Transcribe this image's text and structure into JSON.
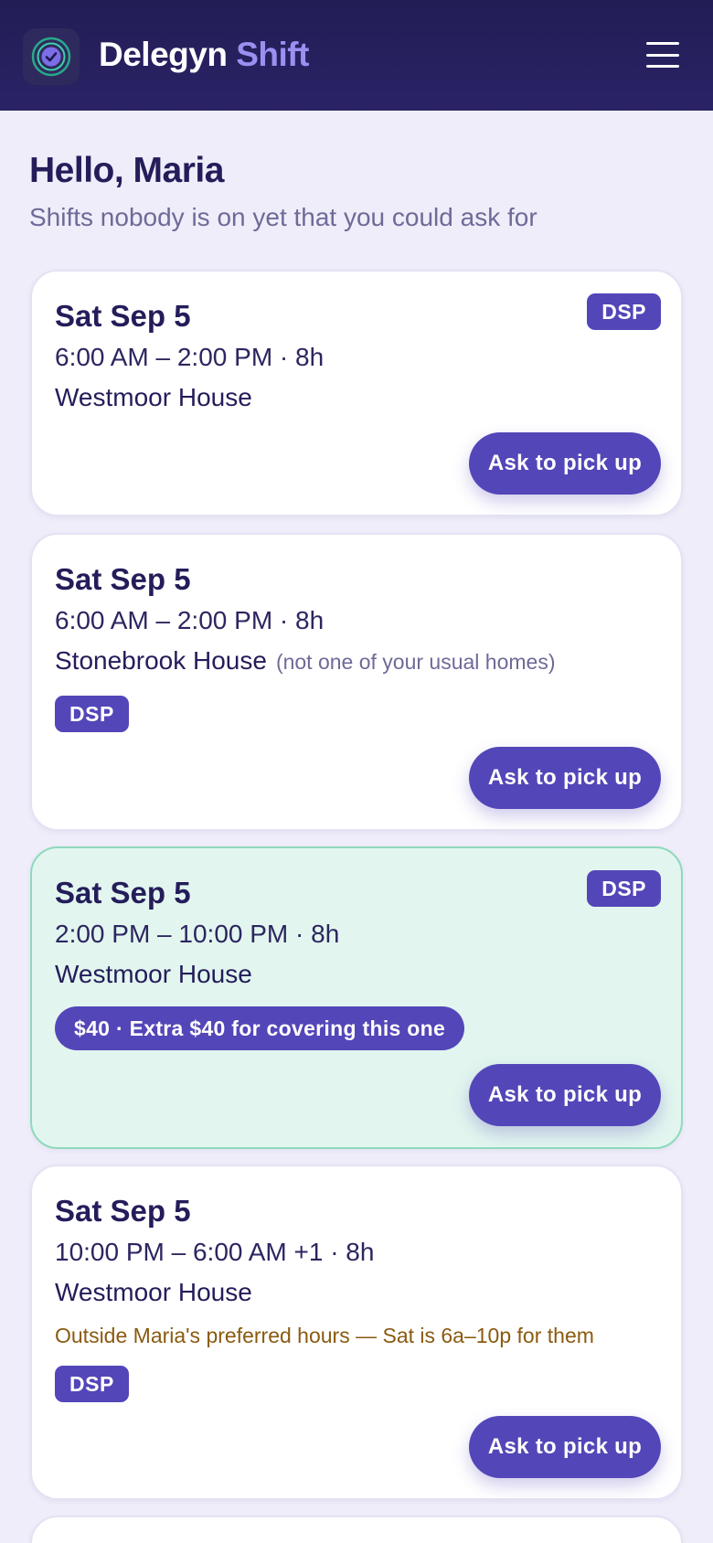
{
  "header": {
    "brand_main": "Delegyn",
    "brand_accent": "Shift",
    "menu_icon": "hamburger-menu-icon",
    "logo_icon": "check-circle-icon"
  },
  "greeting": "Hello, Maria",
  "subtitle": "Shifts nobody is on yet that you could ask for",
  "colors": {
    "header_bg": "#221d55",
    "accent": "#5346b8",
    "brand_accent": "#9b8ff0",
    "highlight_bg": "#e2f6ef",
    "warning_text": "#8a5a10"
  },
  "shifts": [
    {
      "date": "Sat Sep 5",
      "time": "6:00 AM – 2:00 PM · 8h",
      "place": "Westmoor House",
      "role": "DSP",
      "action": "Ask to pick up"
    },
    {
      "date": "Sat Sep 5",
      "time": "6:00 AM – 2:00 PM · 8h",
      "place": "Stonebrook House",
      "place_note": "(not one of your usual homes)",
      "role": "DSP",
      "action": "Ask to pick up"
    },
    {
      "date": "Sat Sep 5",
      "time": "2:00 PM – 10:00 PM · 8h",
      "place": "Westmoor House",
      "role": "DSP",
      "bonus": "$40 · Extra $40 for covering this one",
      "action": "Ask to pick up"
    },
    {
      "date": "Sat Sep 5",
      "time": "10:00 PM – 6:00 AM +1 · 8h",
      "place": "Westmoor House",
      "warning": "Outside Maria's preferred hours — Sat is 6a–10p for them",
      "role": "DSP",
      "action": "Ask to pick up"
    }
  ]
}
